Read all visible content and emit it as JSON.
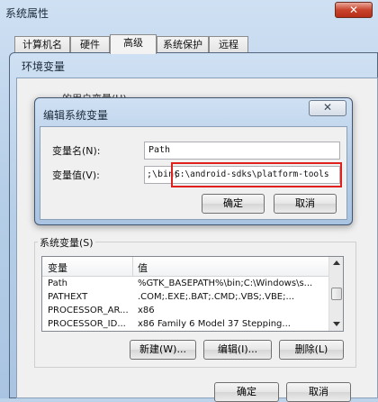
{
  "outer_window": {
    "title": "系统属性",
    "close_glyph": "✕"
  },
  "tabs": [
    "计算机名",
    "硬件",
    "高级",
    "系统保护",
    "远程"
  ],
  "env_window": {
    "title": "环境变量",
    "user_vars_partial": "…的用户变量(U)"
  },
  "edit_dialog": {
    "title": "编辑系统变量",
    "name_label": "变量名(N):",
    "name_value": "Path",
    "value_label": "变量值(V):",
    "value_prefix": ";\\bin;",
    "value_highlight": "G:\\android-sdks\\platform-tools",
    "ok": "确定",
    "cancel": "取消",
    "close_glyph": "✕"
  },
  "system_vars": {
    "label": "系统变量(S)",
    "headers": [
      "变量",
      "值"
    ],
    "rows": [
      {
        "name": "Path",
        "value": "%GTK_BASEPATH%\\bin;C:\\Windows\\s..."
      },
      {
        "name": "PATHEXT",
        "value": ".COM;.EXE;.BAT;.CMD;.VBS;.VBE;..."
      },
      {
        "name": "PROCESSOR_AR...",
        "value": "x86"
      },
      {
        "name": "PROCESSOR_ID...",
        "value": "x86 Family 6 Model 37 Stepping..."
      }
    ],
    "new_button": "新建(W)...",
    "edit_button": "编辑(I)...",
    "delete_button": "删除(L)"
  },
  "bottom_buttons": {
    "ok": "确定",
    "cancel": "取消"
  },
  "colors": {
    "highlight_border": "#e0201c",
    "glass": "#b7cfe8"
  }
}
